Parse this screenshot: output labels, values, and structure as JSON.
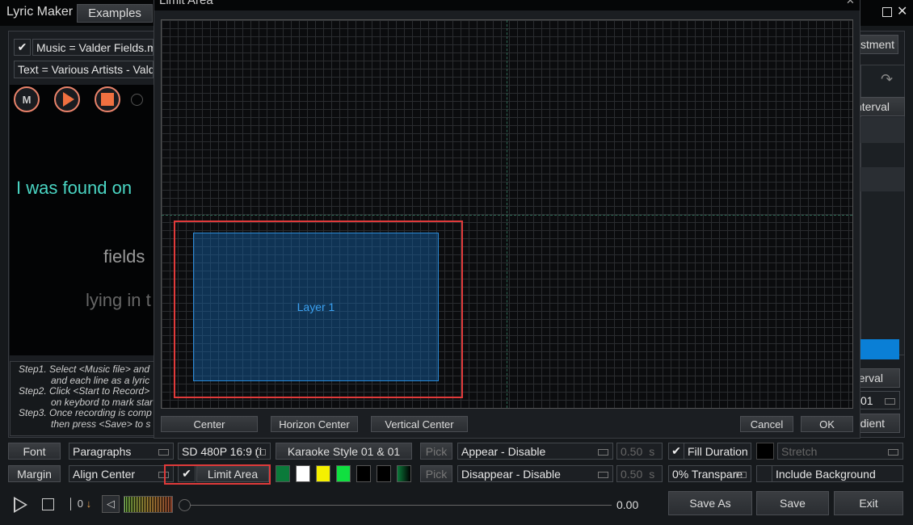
{
  "window": {
    "title": "Lyric Maker",
    "examples_tab": "Examples"
  },
  "file": {
    "music": "Music = Valder Fields.m",
    "text": "Text = Various Artists - Vald",
    "music_checked": true
  },
  "lyrics": {
    "current": "I was found on",
    "next": "fields",
    "after": "lying in t"
  },
  "steps": [
    "Step1. Select <Music file> and",
    "and each line as a lyric",
    "Step2. Click <Start to Record>",
    "on keybord to mark star",
    "Step3. Once recording is comp",
    "then press <Save> to s"
  ],
  "right_panel": {
    "adjustment": "ustment",
    "interval_header": "nterval",
    "interval_btn": "erval",
    "select_value": "01",
    "gradient_btn": "dient",
    "accent": "#0a7fd6"
  },
  "dialog": {
    "title": "Limit Area",
    "layer_label": "Layer 1",
    "center": "Center",
    "horizon_center": "Horizon Center",
    "vertical_center": "Vertical Center",
    "cancel": "Cancel",
    "ok": "OK"
  },
  "controls": {
    "font": "Font",
    "margin": "Margin",
    "paragraphs": "Paragraphs",
    "align": "Align Center",
    "resolution": "SD 480P 16:9 (I",
    "karaoke_style": "Karaoke Style 01 & 01",
    "limit_area": "Limit Area",
    "limit_area_checked": true,
    "pick1": "Pick",
    "pick2": "Pick",
    "appear": "Appear - Disable",
    "disappear": "Disappear - Disable",
    "appear_time": "0.50",
    "disappear_time": "0.50",
    "unit": "s",
    "fill_duration": "Fill Duration",
    "fill_duration_checked": true,
    "stretch": "Stretch",
    "transparency": "0% Transpare",
    "include_background": "Include Background",
    "include_background_checked": false,
    "swatches": [
      "#0b7a3a",
      "#ffffff",
      "#f5f000",
      "#10e040",
      "#000000",
      "#000000",
      "gradient"
    ]
  },
  "playback": {
    "counter": "0",
    "time": "0.00",
    "save_as": "Save As",
    "save": "Save",
    "exit": "Exit"
  }
}
